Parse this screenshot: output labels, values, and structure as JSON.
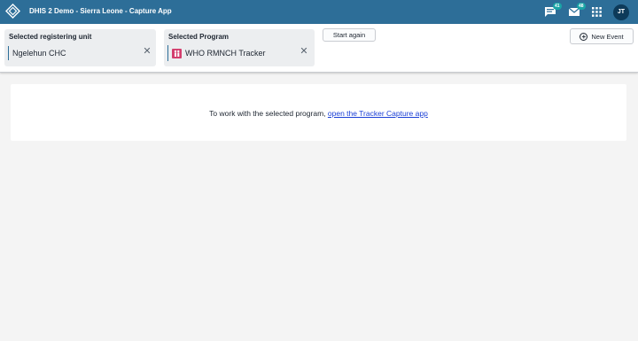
{
  "header": {
    "title": "DHIS 2 Demo - Sierra Leone - Capture App",
    "interpretations_badge": "41",
    "messages_badge": "48",
    "avatar_initials": "JT",
    "bg_color": "#2d6e98"
  },
  "context": {
    "org_unit": {
      "label": "Selected registering unit",
      "value": "Ngelehun CHC"
    },
    "program": {
      "label": "Selected Program",
      "value": "WHO RMNCH Tracker",
      "icon_color": "#d33e6d"
    },
    "start_again_label": "Start again",
    "new_event_label": "New Event"
  },
  "main": {
    "message": "To work with the selected program,",
    "link_text": "open the Tracker Capture app"
  },
  "icons": {
    "logo": "dhis2-logo-icon",
    "interpretations": "chat-bubble-icon",
    "messages": "envelope-icon",
    "apps": "apps-grid-icon",
    "clear": "close-icon",
    "add": "plus-circle-icon"
  }
}
